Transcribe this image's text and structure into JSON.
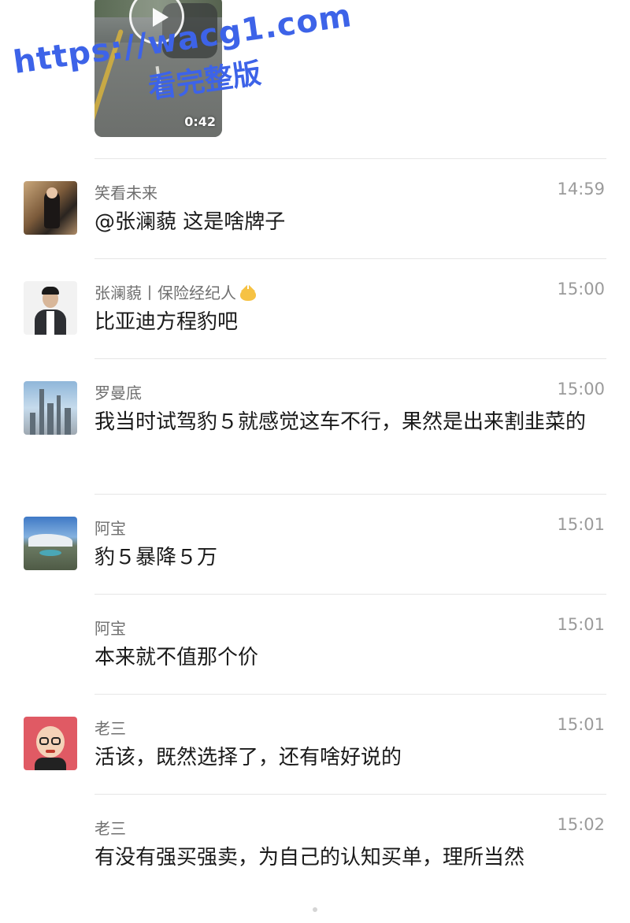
{
  "video": {
    "duration": "0:42",
    "icon": "play-icon"
  },
  "watermark": {
    "url": "https://wacg1.com",
    "subtitle": "看完整版"
  },
  "comments": [
    {
      "author": "笑看未来",
      "time": "14:59",
      "text": "@张澜藐 这是啥牌子",
      "avatar": "avatar-woman"
    },
    {
      "author": "张澜藐丨保险经纪人",
      "author_emoji": "cat-face-icon",
      "time": "15:00",
      "text": "比亚迪方程豹吧",
      "avatar": "avatar-man-suit"
    },
    {
      "author": "罗曼底",
      "time": "15:00",
      "text": "我当时试驾豹５就感觉这车不行，果然是出来割韭菜的",
      "avatar": "avatar-city-skyline"
    },
    {
      "author": "阿宝",
      "time": "15:01",
      "text": "豹５暴降５万",
      "avatar": "avatar-mountain-lake"
    },
    {
      "author": "阿宝",
      "time": "15:01",
      "text": "本来就不值那个价",
      "avatar": null
    },
    {
      "author": "老三",
      "time": "15:01",
      "text": "活该，既然选择了，还有啥好说的",
      "avatar": "avatar-cartoon-man"
    },
    {
      "author": "老三",
      "time": "15:02",
      "text": "有没有强买强卖，为自己的认知买单，理所当然",
      "avatar": null
    }
  ]
}
